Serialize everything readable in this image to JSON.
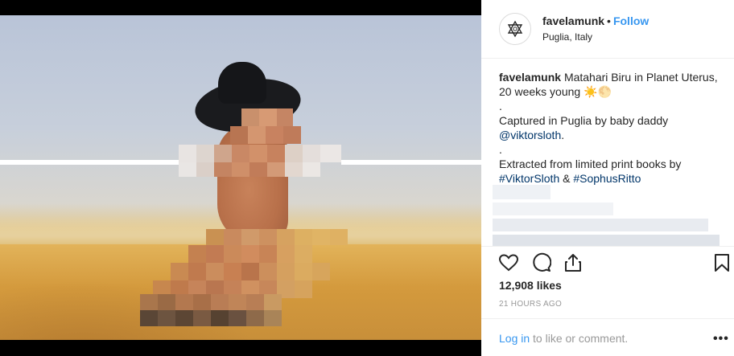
{
  "post": {
    "username": "favelamunk",
    "separator": "•",
    "follow_label": "Follow",
    "location": "Puglia, Italy"
  },
  "caption": {
    "username": "favelamunk",
    "line1": "Matahari Biru in Planet Uterus, 20 weeks young ☀️🌕",
    "dot1": ".",
    "line2_prefix": "Captured in Puglia by baby daddy",
    "mention": "@viktorsloth",
    "line2_suffix": ".",
    "dot2": ".",
    "line3_prefix": "Extracted from limited print books by",
    "hashtag1": "#ViktorSloth",
    "amp": "&",
    "hashtag2": "#SophusRitto"
  },
  "actions": {
    "like_icon": "heart-icon",
    "comment_icon": "comment-icon",
    "share_icon": "share-icon",
    "save_icon": "bookmark-icon"
  },
  "likes": "12,908 likes",
  "timestamp": "21 HOURS AGO",
  "footer": {
    "login_label": "Log in",
    "login_suffix": "to like or comment.",
    "more_label": "•••"
  },
  "colors": {
    "link_blue": "#3897f0",
    "text": "#262626",
    "muted": "#999999",
    "mention": "#003569"
  }
}
